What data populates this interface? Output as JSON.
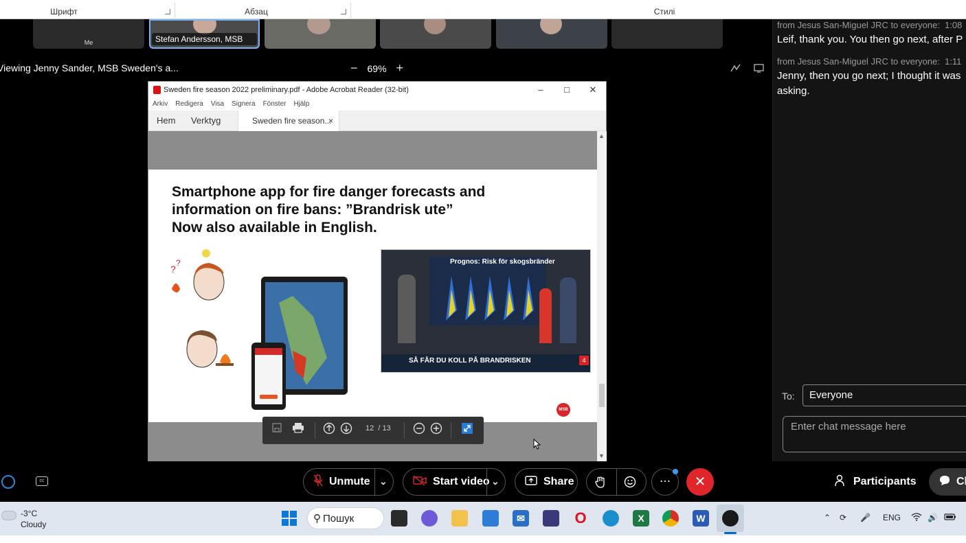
{
  "ribbon": {
    "groups": [
      "Шрифт",
      "Абзац",
      "Стилі"
    ]
  },
  "meeting": {
    "thumbnails": [
      {
        "label": "Me",
        "active": false
      },
      {
        "label": "Stefan Andersson, MSB S...",
        "active": true
      },
      {
        "label": "",
        "active": false
      },
      {
        "label": "",
        "active": false
      },
      {
        "label": "",
        "active": false
      },
      {
        "label": "",
        "active": false
      }
    ],
    "viewing_text": "Viewing Jenny Sander, MSB Sweden's a...",
    "zoom": "69%",
    "zoom_out": "−",
    "zoom_in": "+"
  },
  "acrobat": {
    "window_title": "Sweden fire season 2022 preliminary.pdf - Adobe Acrobat Reader (32-bit)",
    "menu": [
      "Arkiv",
      "Redigera",
      "Visa",
      "Signera",
      "Fönster",
      "Hjälp"
    ],
    "tabs": {
      "home": "Hem",
      "tools": "Verktyg",
      "doc": "Sweden fire season...",
      "close": "×"
    },
    "slide": {
      "title_line1": "Smartphone app for fire danger forecasts and",
      "title_line2": "information on fire bans: ”Brandrisk ute”",
      "title_line3": "Now also available in English.",
      "tv_header": "Prognos: Risk för skogsbränder",
      "tv_caption": "SÅ FÅR DU KOLL PÅ BRANDRISKEN",
      "tv_channel": "4",
      "logo_text": "MSB"
    },
    "toolbar": {
      "page_current": "12",
      "page_total": "/ 13"
    }
  },
  "chat": {
    "messages": [
      {
        "meta": "from Jesus San-Miguel JRC to everyone:",
        "time": "1:08",
        "lines": [
          "Leif, thank you. You then go next, after P"
        ]
      },
      {
        "meta": "from Jesus San-Miguel JRC to everyone:",
        "time": "1:11",
        "lines": [
          "Jenny, then you go next; I thought it was",
          "asking."
        ]
      }
    ],
    "to_label": "To:",
    "to_value": "Everyone",
    "input_placeholder": "Enter chat message here"
  },
  "controls": {
    "unmute": "Unmute",
    "start_video": "Start video",
    "share": "Share",
    "participants": "Participants",
    "chat": "Ch"
  },
  "taskbar": {
    "temperature": "-3°C",
    "condition": "Cloudy",
    "search": "Пошук",
    "language": "ENG",
    "colors": {
      "accent": "#0067c0",
      "end_call": "#e0262a"
    }
  }
}
